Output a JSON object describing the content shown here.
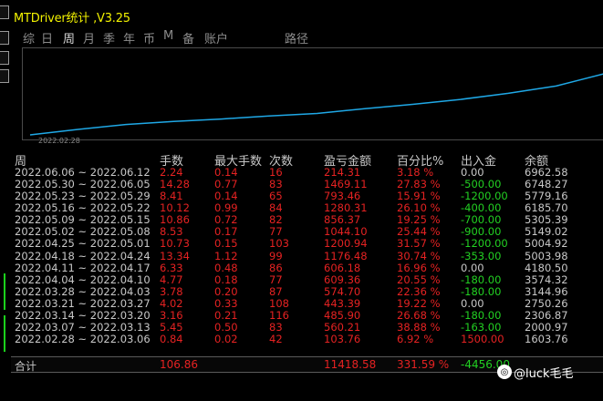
{
  "window": {
    "title": "MTDriver统计 ,V3.25"
  },
  "menu": [
    {
      "label": "综",
      "active": false
    },
    {
      "label": "日",
      "active": false
    },
    {
      "label": "周",
      "active": true
    },
    {
      "label": "月",
      "active": false
    },
    {
      "label": "季",
      "active": false
    },
    {
      "label": "年",
      "active": false
    },
    {
      "label": "币",
      "active": false
    },
    {
      "label": "M",
      "active": false
    },
    {
      "label": "备",
      "active": false
    },
    {
      "label": "账户",
      "active": false
    },
    {
      "label": "路径",
      "active": false
    }
  ],
  "chart": {
    "x_label": "2022.02.28",
    "curve": [
      0.0,
      0.09,
      0.17,
      0.22,
      0.26,
      0.31,
      0.35,
      0.43,
      0.5,
      0.58,
      0.68,
      0.8,
      1.0
    ]
  },
  "columns": {
    "week": "周",
    "lots": "手数",
    "max_lot": "最大手数",
    "count": "次数",
    "pl": "盈亏金额",
    "pct": "百分比%",
    "flow": "出入金",
    "balance": "余额"
  },
  "rows": [
    {
      "week": "2022.06.06 ~ 2022.06.12",
      "lots": "2.24",
      "max_lot": "0.14",
      "count": "16",
      "pl": "214.31",
      "pct": "3.18 %",
      "flow": "0.00",
      "balance": "6962.58"
    },
    {
      "week": "2022.05.30 ~ 2022.06.05",
      "lots": "14.28",
      "max_lot": "0.77",
      "count": "83",
      "pl": "1469.11",
      "pct": "27.83 %",
      "flow": "-500.00",
      "balance": "6748.27"
    },
    {
      "week": "2022.05.23 ~ 2022.05.29",
      "lots": "8.41",
      "max_lot": "0.14",
      "count": "65",
      "pl": "793.46",
      "pct": "15.91 %",
      "flow": "-1200.00",
      "balance": "5779.16"
    },
    {
      "week": "2022.05.16 ~ 2022.05.22",
      "lots": "10.12",
      "max_lot": "0.99",
      "count": "84",
      "pl": "1280.31",
      "pct": "26.10 %",
      "flow": "-400.00",
      "balance": "6185.70"
    },
    {
      "week": "2022.05.09 ~ 2022.05.15",
      "lots": "10.86",
      "max_lot": "0.72",
      "count": "82",
      "pl": "856.37",
      "pct": "19.25 %",
      "flow": "-700.00",
      "balance": "5305.39"
    },
    {
      "week": "2022.05.02 ~ 2022.05.08",
      "lots": "8.53",
      "max_lot": "0.17",
      "count": "77",
      "pl": "1044.10",
      "pct": "25.44 %",
      "flow": "-900.00",
      "balance": "5149.02"
    },
    {
      "week": "2022.04.25 ~ 2022.05.01",
      "lots": "10.73",
      "max_lot": "0.15",
      "count": "103",
      "pl": "1200.94",
      "pct": "31.57 %",
      "flow": "-1200.00",
      "balance": "5004.92"
    },
    {
      "week": "2022.04.18 ~ 2022.04.24",
      "lots": "13.34",
      "max_lot": "1.12",
      "count": "99",
      "pl": "1176.48",
      "pct": "30.74 %",
      "flow": "-353.00",
      "balance": "5003.98"
    },
    {
      "week": "2022.04.11 ~ 2022.04.17",
      "lots": "6.33",
      "max_lot": "0.48",
      "count": "86",
      "pl": "606.18",
      "pct": "16.96 %",
      "flow": "0.00",
      "balance": "4180.50"
    },
    {
      "week": "2022.04.04 ~ 2022.04.10",
      "lots": "4.77",
      "max_lot": "0.18",
      "count": "77",
      "pl": "609.36",
      "pct": "20.55 %",
      "flow": "-180.00",
      "balance": "3574.32"
    },
    {
      "week": "2022.03.28 ~ 2022.04.03",
      "lots": "3.78",
      "max_lot": "0.20",
      "count": "87",
      "pl": "574.70",
      "pct": "22.36 %",
      "flow": "-180.00",
      "balance": "3144.96"
    },
    {
      "week": "2022.03.21 ~ 2022.03.27",
      "lots": "4.02",
      "max_lot": "0.33",
      "count": "108",
      "pl": "443.39",
      "pct": "19.22 %",
      "flow": "0.00",
      "balance": "2750.26"
    },
    {
      "week": "2022.03.14 ~ 2022.03.20",
      "lots": "3.16",
      "max_lot": "0.21",
      "count": "116",
      "pl": "485.90",
      "pct": "26.68 %",
      "flow": "-180.00",
      "balance": "2306.87"
    },
    {
      "week": "2022.03.07 ~ 2022.03.13",
      "lots": "5.45",
      "max_lot": "0.50",
      "count": "83",
      "pl": "560.21",
      "pct": "38.88 %",
      "flow": "-163.00",
      "balance": "2000.97"
    },
    {
      "week": "2022.02.28 ~ 2022.03.06",
      "lots": "0.84",
      "max_lot": "0.02",
      "count": "42",
      "pl": "103.76",
      "pct": "6.92 %",
      "flow": "1500.00",
      "balance": "1603.76"
    }
  ],
  "total": {
    "label": "合计",
    "lots": "106.86",
    "pl": "11418.58",
    "pct": "331.59 %",
    "flow": "-4456.00"
  },
  "watermark": {
    "text": "@luck毛毛"
  },
  "colors": {
    "title": "#f2f200",
    "positive": "#e52222",
    "negative": "#22d022",
    "curve": "#1fa8e6"
  }
}
